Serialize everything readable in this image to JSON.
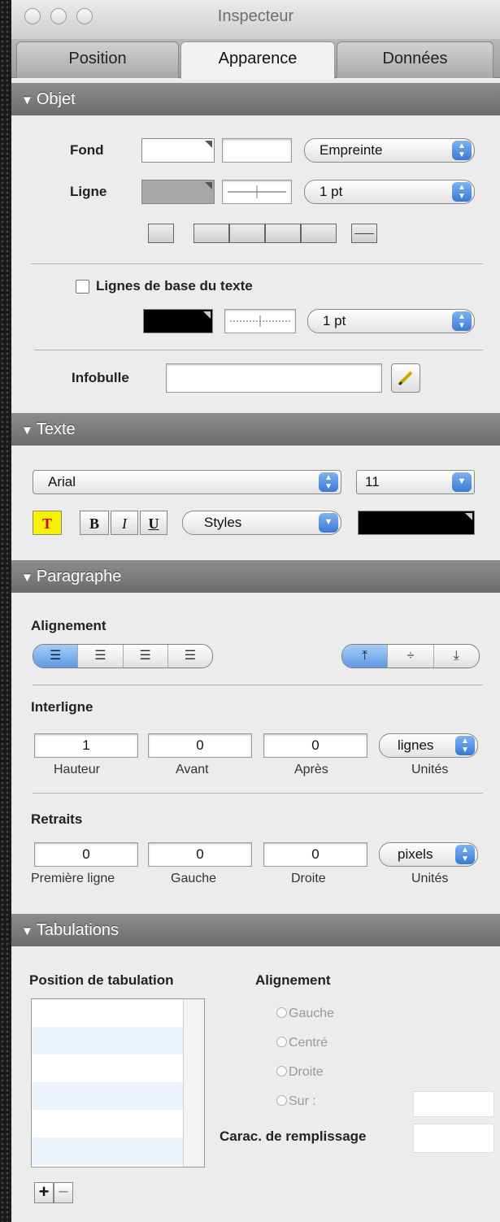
{
  "window": {
    "title": "Inspecteur"
  },
  "tabs": [
    {
      "label": "Position"
    },
    {
      "label": "Apparence"
    },
    {
      "label": "Données"
    }
  ],
  "objet": {
    "header": "Objet",
    "fond_label": "Fond",
    "fond_select": "Empreinte",
    "ligne_label": "Ligne",
    "ligne_select": "1 pt",
    "baseline_checkbox": "Lignes de base du texte",
    "baseline_select": "1 pt",
    "infobulle_label": "Infobulle",
    "infobulle_value": ""
  },
  "texte": {
    "header": "Texte",
    "font": "Arial",
    "size": "11",
    "style_t": "T",
    "style_b": "B",
    "style_i": "I",
    "style_u": "U",
    "styles_select": "Styles"
  },
  "paragraphe": {
    "header": "Paragraphe",
    "alignement_label": "Alignement",
    "interligne_label": "Interligne",
    "interligne": {
      "hauteur": "1",
      "avant": "0",
      "apres": "0",
      "unites": "lignes",
      "hauteur_label": "Hauteur",
      "avant_label": "Avant",
      "apres_label": "Après",
      "unites_label": "Unités"
    },
    "retraits_label": "Retraits",
    "retraits": {
      "premiere": "0",
      "gauche": "0",
      "droite": "0",
      "unites": "pixels",
      "premiere_label": "Première ligne",
      "gauche_label": "Gauche",
      "droite_label": "Droite",
      "unites_label": "Unités"
    }
  },
  "tabulations": {
    "header": "Tabulations",
    "position_label": "Position de tabulation",
    "alignement_label": "Alignement",
    "radio_gauche": "Gauche",
    "radio_centre": "Centré",
    "radio_droite": "Droite",
    "radio_sur": "Sur :",
    "remplissage_label": "Carac. de remplissage",
    "add": "+",
    "remove": "−"
  },
  "colors": {
    "accent": "#5d99e4",
    "highlight": "#f6f200",
    "section": "#7a7a7a"
  }
}
